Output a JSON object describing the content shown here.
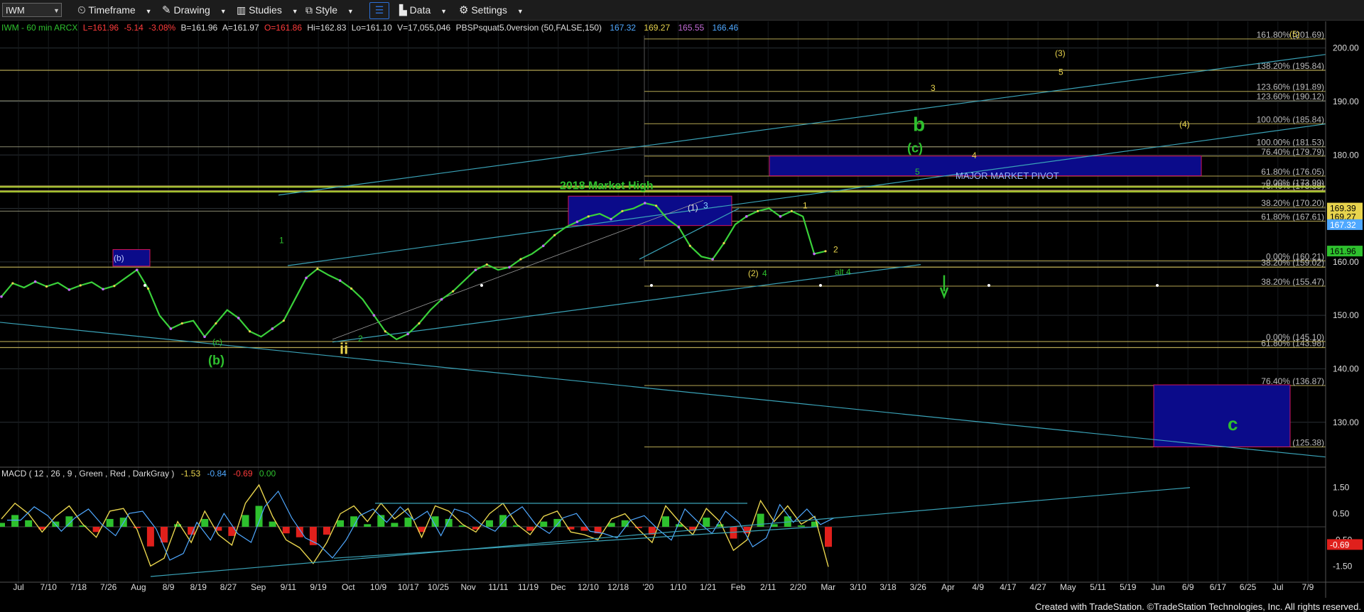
{
  "toolbar": {
    "symbol": "IWM",
    "timeframe": "Timeframe",
    "drawing": "Drawing",
    "studies": "Studies",
    "style": "Style",
    "data": "Data",
    "settings": "Settings"
  },
  "info": {
    "name": "IWM - 60 min  ARCX",
    "L": "L=161.96",
    "chg": "-5.14",
    "pct": "-3.08%",
    "B": "B=161.96",
    "A": "A=161.97",
    "O": "O=161.86",
    "Hi": "Hi=162.83",
    "Lo": "Lo=161.10",
    "vol": "V=17,055,046",
    "study": "PBSPsquat5.0version (50,FALSE,150)",
    "v1": "167.32",
    "v2": "169.27",
    "v3": "165.55",
    "v4": "166.46"
  },
  "macd_label": {
    "title": "MACD ( 12 , 26 , 9 , Green , Red , DarkGray )",
    "v1": "-1.53",
    "v2": "-0.84",
    "v3": "-0.69",
    "v4": "0.00"
  },
  "colors": {
    "background": "#000000",
    "grid": "#2a3035",
    "price": "#3ad13a",
    "fib": "#b3a552",
    "trend": "#3aa3b8",
    "box": "#0b0b8a",
    "box_border": "#d4145a",
    "green_label": "#2ec02e",
    "yellow_label": "#e8d44d"
  },
  "chart_data": {
    "type": "line",
    "title": "",
    "ylim": [
      122,
      205
    ],
    "y_ticks": [
      "200.00",
      "190.00",
      "180.00",
      "170.00",
      "160.00",
      "150.00",
      "140.00",
      "130.00"
    ],
    "x_ticks": [
      "Jul",
      "7/10",
      "7/18",
      "7/26",
      "Aug",
      "8/9",
      "8/19",
      "8/27",
      "Sep",
      "9/11",
      "9/19",
      "Oct",
      "10/9",
      "10/17",
      "10/25",
      "Nov",
      "11/11",
      "11/19",
      "Dec",
      "12/10",
      "12/18",
      "'20",
      "1/10",
      "1/21",
      "Feb",
      "2/11",
      "2/20",
      "Mar",
      "3/10",
      "3/18",
      "3/26",
      "Apr",
      "4/9",
      "4/17",
      "4/27",
      "May",
      "5/11",
      "5/19",
      "Jun",
      "6/9",
      "6/17",
      "6/25",
      "Jul",
      "7/9"
    ],
    "series": [
      {
        "values": [
          153.5,
          156,
          155.2,
          156.3,
          155.4,
          156.1,
          154.8,
          155.6,
          156.2,
          154.9,
          155.5,
          157,
          158.5,
          155,
          150,
          147.5,
          148.5,
          149,
          146,
          148.5,
          151,
          149.5,
          147,
          146,
          147.5,
          149,
          153,
          157,
          158.7,
          157.5,
          156.5,
          155,
          153,
          150,
          147,
          145.5,
          146.5,
          148.5,
          151,
          153,
          154.5,
          156.5,
          158.5,
          159.5,
          158.5,
          159,
          160.5,
          161.5,
          163,
          165,
          166.5,
          167.5,
          168.5,
          169,
          168,
          169.5,
          170,
          171,
          170.5,
          168,
          166.5,
          163,
          161,
          160.5,
          163.5,
          167,
          168.5,
          169.5,
          170,
          168.5,
          169.5,
          168.5,
          161.5,
          162
        ]
      }
    ],
    "price_labels": {
      "last": "161.96",
      "l1": "169.39",
      "l2": "169.27",
      "l3": "167.32"
    },
    "fib_levels": [
      {
        "label": "161.80% (201.69)",
        "value": 201.69
      },
      {
        "label": "138.20% (195.84)",
        "value": 195.84
      },
      {
        "label": "123.60% (191.89)",
        "value": 191.89
      },
      {
        "label": "123.60% (190.12)",
        "value": 190.12
      },
      {
        "label": "100.00% (185.84)",
        "value": 185.84
      },
      {
        "label": "100.00% (181.53)",
        "value": 181.53
      },
      {
        "label": "76.40% (179.79)",
        "value": 179.79
      },
      {
        "label": "61.80% (176.05)",
        "value": 176.05
      },
      {
        "label": "0.00% (173.99)",
        "value": 173.99
      },
      {
        "label": "76.40% (173.39)",
        "value": 173.39
      },
      {
        "label": "38.20% (170.20)",
        "value": 170.2
      },
      {
        "label": "61.80% (167.61)",
        "value": 167.61
      },
      {
        "label": "0.00% (160.21)",
        "value": 160.21
      },
      {
        "label": "38.20% (159.02)",
        "value": 159.02
      },
      {
        "label": "38.20% (155.47)",
        "value": 155.47
      },
      {
        "label": "0.00% (145.10)",
        "value": 145.1
      },
      {
        "label": "61.80% (143.98)",
        "value": 143.98
      },
      {
        "label": "76.40% (136.87)",
        "value": 136.87
      },
      {
        "label": "100.00% (125.38)",
        "value": 125.38
      }
    ],
    "annotations": {
      "market_high": "2018 Market High",
      "pivot": "MAJOR MARKET PIVOT",
      "wave_b": "b",
      "wave_c_paren": "(c)",
      "wave_b_paren": "(b)",
      "wave_b_small": "(b)",
      "wave_c_small": "(c)",
      "wave_ii": "ii",
      "wave_1": "1",
      "wave_2": "2",
      "wave_p1": "(1)",
      "wave_3": "3",
      "wave_p2": "(2)",
      "wave_4": "4",
      "wave_1b": "1",
      "wave_2b": "2",
      "alt4": "alt 4",
      "wave_5": "5",
      "wave_4y": "4",
      "wave_3y": "3",
      "wave_5y": "5",
      "wave_p3": "(3)",
      "wave_p5": "(5)",
      "wave_p4": "(4)",
      "target_c": "c"
    },
    "macd": {
      "y_ticks": [
        "1.50",
        "0.50",
        "-0.50",
        "-1.50"
      ],
      "ylim": [
        -1.9,
        1.9
      ],
      "current": "-0.69",
      "macd_values": [
        0.3,
        0.9,
        0.5,
        -0.2,
        0.4,
        0.8,
        0.1,
        -0.4,
        0.6,
        0.7,
        -0.1,
        -1.5,
        -1.2,
        0.2,
        -0.6,
        0.6,
        -0.3,
        -0.7,
        0.9,
        1.6,
        0.4,
        -0.5,
        -0.8,
        -1.4,
        -0.6,
        0.5,
        0.8,
        0.2,
        0.9,
        0.3,
        0.7,
        -0.4,
        0.8,
        0.6,
        0.1,
        -0.2,
        0.5,
        0.9,
        0.1,
        -0.3,
        0.4,
        0.6,
        -0.2,
        -0.3,
        -0.5,
        0.3,
        0.5,
        -0.1,
        -0.6,
        0.8,
        0.2,
        -0.3,
        0.7,
        0.2,
        -0.9,
        -0.5,
        1.0,
        0.2,
        0.8,
        0.1,
        0.4,
        -1.53
      ]
    }
  }
}
